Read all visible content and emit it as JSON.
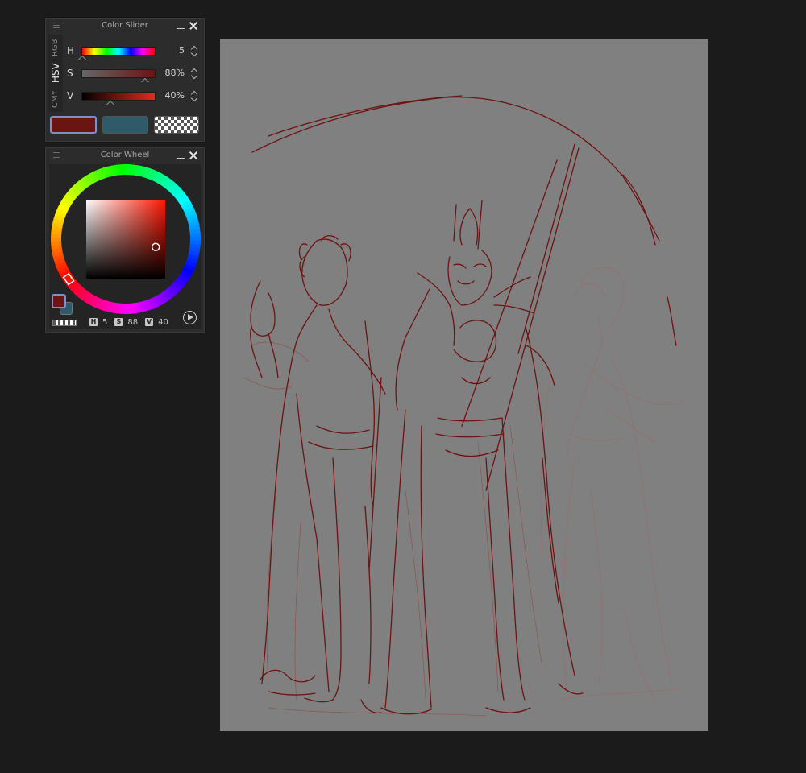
{
  "color_slider": {
    "title": "Color Slider",
    "modes": [
      "RGB",
      "HSV",
      "CMY"
    ],
    "active_mode": "HSV",
    "sliders": [
      {
        "label": "H",
        "value": "5",
        "fraction": 0.014
      },
      {
        "label": "S",
        "value": "88%",
        "fraction": 0.88
      },
      {
        "label": "V",
        "value": "40%",
        "fraction": 0.4
      }
    ],
    "main_color": "#6b1414",
    "sub_color": "#2f5a6a"
  },
  "color_wheel": {
    "title": "Color Wheel",
    "readout": {
      "h_label": "H",
      "h": "5",
      "s_label": "S",
      "s": "88",
      "v_label": "V",
      "v": "40"
    },
    "hue": 5,
    "saturation": 0.88,
    "value": 0.4
  },
  "canvas": {
    "background": "#808080",
    "stroke_color": "#6e1212"
  }
}
